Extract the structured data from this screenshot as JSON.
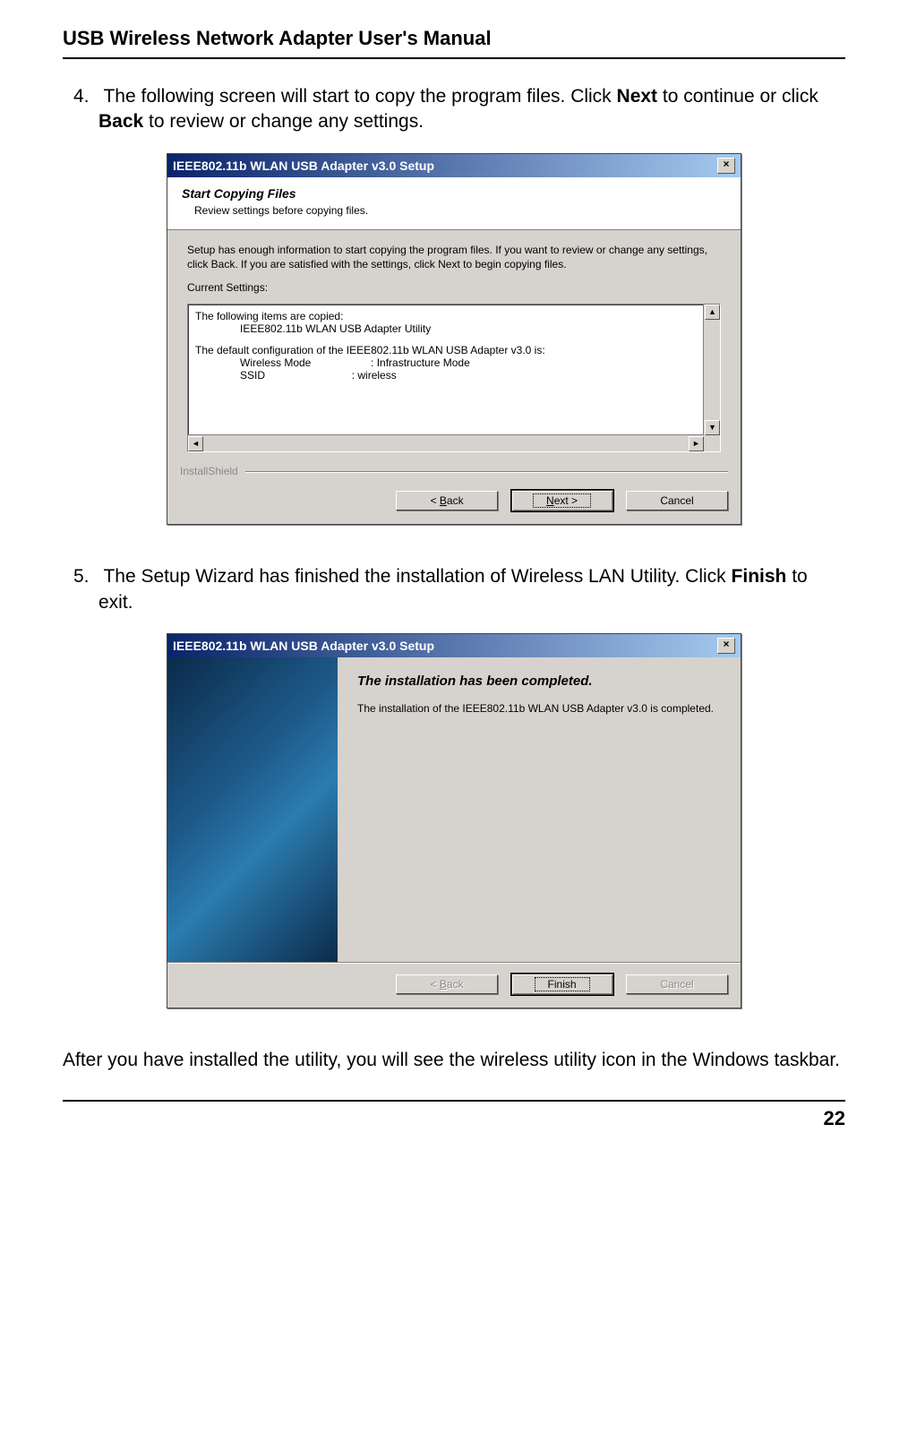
{
  "doc_header": "USB Wireless Network Adapter User's Manual",
  "page_number": "22",
  "step4": {
    "num": "4.",
    "text_a": "The following screen will start to copy the program files. Click ",
    "bold_a": "Next",
    "text_b": " to continue or click ",
    "bold_b": "Back",
    "text_c": " to review or change any settings."
  },
  "step5": {
    "num": "5.",
    "text_a": "The Setup Wizard has finished the installation of Wireless LAN Utility. Click ",
    "bold_a": "Finish",
    "text_b": " to exit."
  },
  "bottom_text": "After you have installed the utility, you will see the wireless utility icon in the Windows taskbar.",
  "dialog1": {
    "title": "IEEE802.11b WLAN USB Adapter v3.0 Setup",
    "close": "×",
    "header_title": "Start Copying Files",
    "header_sub": "Review settings before copying files.",
    "para": "Setup has enough information to start copying the program files.  If you want to review or change any settings, click Back.  If you are satisfied with the settings, click Next to begin copying files.",
    "current_label": "Current Settings:",
    "line1": "The following items are copied:",
    "line2": "IEEE802.11b WLAN USB Adapter Utility",
    "line3": "The default configuration of the IEEE802.11b WLAN USB Adapter v3.0 is:",
    "cfg1": "Wireless Mode                    : Infrastructure Mode",
    "cfg2": "SSID                             : wireless",
    "installshield": "InstallShield",
    "back_u": "B",
    "back": "ack",
    "back_pre": "< ",
    "next_u": "N",
    "next": "ext >",
    "cancel": "Cancel",
    "arrow_up": "▲",
    "arrow_down": "▼",
    "arrow_left": "◄",
    "arrow_right": "►"
  },
  "dialog2": {
    "title": "IEEE802.11b WLAN USB Adapter v3.0 Setup",
    "close": "×",
    "main_title": "The installation has been completed.",
    "main_text": "The installation of the IEEE802.11b WLAN USB Adapter v3.0 is completed.",
    "back_u": "B",
    "back": "ack",
    "back_pre": "< ",
    "finish": "Finish",
    "cancel": "Cancel"
  }
}
